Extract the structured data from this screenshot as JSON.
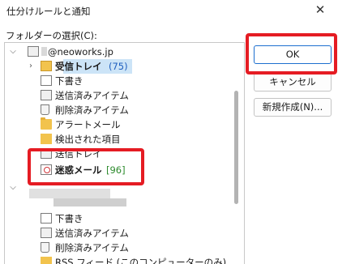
{
  "dialog": {
    "title": "仕分けルールと通知",
    "close_glyph": "✕"
  },
  "folder_section": {
    "label": "フォルダーの選択(C):"
  },
  "account1": {
    "name": "@neoworks.jp"
  },
  "folders1": {
    "inbox": "受信トレイ",
    "inbox_count": "(75)",
    "drafts": "下書き",
    "sent": "送信済みアイテム",
    "deleted": "削除済みアイテム",
    "alert": "アラートメール",
    "search": "検出された項目",
    "outbox": "送信トレイ",
    "junk": "迷惑メール",
    "junk_count": "[96]"
  },
  "folders2": {
    "drafts": "下書き",
    "sent": "送信済みアイテム",
    "deleted": "削除済みアイテム",
    "rss": "RSS フィード (このコンピューターのみ)"
  },
  "buttons": {
    "ok": "OK",
    "cancel": "キャンセル",
    "new_folder": "新規作成(N)..."
  },
  "colors": {
    "highlight": "#e51c23",
    "selection": "#cce4f7",
    "inbox_count": "#1f5fbf",
    "junk_count": "#2e8b2e"
  }
}
